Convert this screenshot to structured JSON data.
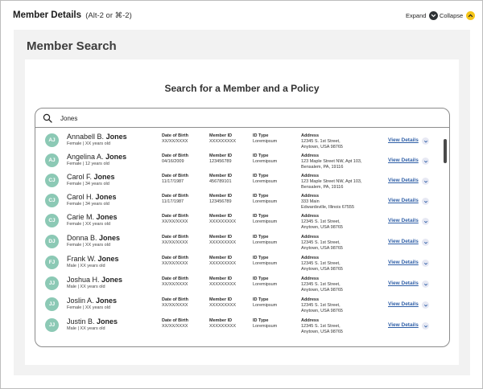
{
  "header": {
    "title": "Member Details",
    "shortcut_hint": "(Alt-2 or ⌘-2)",
    "expand_label": "Expand",
    "collapse_label": "Collapse"
  },
  "page": {
    "title": "Member Search",
    "card_title": "Search for a Member and a Policy"
  },
  "search": {
    "value": "Jones",
    "placeholder": ""
  },
  "columns": {
    "dob": "Date of Birth",
    "member_id": "Member ID",
    "id_type": "ID Type",
    "address": "Address"
  },
  "view_details_label": "View Details",
  "colors": {
    "avatar": "#8cc9b5",
    "link": "#2f5fa7",
    "collapse_button": "#f5c518",
    "expand_button": "#2f3336"
  },
  "members": [
    {
      "initials": "AJ",
      "first": "Annabell B.",
      "last": "Jones",
      "sub": "Female | XX years old",
      "dob": "XX/XX/XXXX",
      "member_id": "XXXXXXXXX",
      "id_type": "Loremipsum",
      "address": [
        "12345 S. 1st Street,",
        "Anytown, USA 98765"
      ]
    },
    {
      "initials": "AJ",
      "first": "Angelina A.",
      "last": "Jones",
      "sub": "Female | 12 years old",
      "dob": "04/16/2009",
      "member_id": "123456789",
      "id_type": "Loremipsum",
      "address": [
        "123 Maple Street NW, Apt 103,",
        "Bensalem, PA, 19116"
      ]
    },
    {
      "initials": "CJ",
      "first": "Carol F.",
      "last": "Jones",
      "sub": "Female | 34 years old",
      "dob": "11/17/1987",
      "member_id": "456789101",
      "id_type": "Loremipsum",
      "address": [
        "123 Maple Street NW, Apt 103,",
        "Bensalem, PA, 19116"
      ]
    },
    {
      "initials": "CJ",
      "first": "Carol H.",
      "last": "Jones",
      "sub": "Female | 34 years old",
      "dob": "11/17/1987",
      "member_id": "123456789",
      "id_type": "Loremipsum",
      "address": [
        "333 Main",
        "Edwardsville, Illinois 67555"
      ]
    },
    {
      "initials": "CJ",
      "first": "Carie M.",
      "last": "Jones",
      "sub": "Female | XX years old",
      "dob": "XX/XX/XXXX",
      "member_id": "XXXXXXXXX",
      "id_type": "Loremipsum",
      "address": [
        "12345 S. 1st Street,",
        "Anytown, USA 98765"
      ]
    },
    {
      "initials": "DJ",
      "first": "Donna  B.",
      "last": "Jones",
      "sub": "Female | XX years old",
      "dob": "XX/XX/XXXX",
      "member_id": "XXXXXXXXX",
      "id_type": "Loremipsum",
      "address": [
        "12345 S. 1st Street,",
        "Anytown, USA 98765"
      ]
    },
    {
      "initials": "FJ",
      "first": "Frank W.",
      "last": "Jones",
      "sub": "Male | XX years old",
      "dob": "XX/XX/XXXX",
      "member_id": "XXXXXXXXX",
      "id_type": "Loremipsum",
      "address": [
        "12345 S. 1st Street,",
        "Anytown, USA 98765"
      ]
    },
    {
      "initials": "JJ",
      "first": "Joshua H.",
      "last": "Jones",
      "sub": "Male | XX years old",
      "dob": "XX/XX/XXXX",
      "member_id": "XXXXXXXXX",
      "id_type": "Loremipsum",
      "address": [
        "12345 S. 1st Street,",
        "Anytown, USA 98765"
      ]
    },
    {
      "initials": "JJ",
      "first": "Joslin A.",
      "last": "Jones",
      "sub": "Female | XX years old",
      "dob": "XX/XX/XXXX",
      "member_id": "XXXXXXXXX",
      "id_type": "Loremipsum",
      "address": [
        "12345 S. 1st Street,",
        "Anytown, USA 98765"
      ]
    },
    {
      "initials": "JJ",
      "first": "Justin  B.",
      "last": "Jones",
      "sub": "Male | XX years old",
      "dob": "XX/XX/XXXX",
      "member_id": "XXXXXXXXX",
      "id_type": "Loremipsum",
      "address": [
        "12345 S. 1st Street,",
        "Anytown, USA 98765"
      ]
    }
  ]
}
